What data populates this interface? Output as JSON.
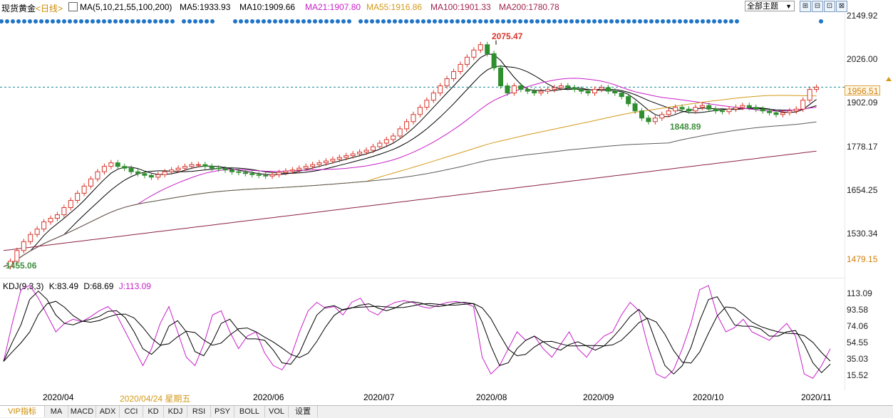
{
  "header": {
    "symbol": "现货黄金",
    "period": "<日线>",
    "ma_params": "MA(5,10,21,55,100,200)",
    "ma5": "MA5:1933.93",
    "ma10": "MA10:1909.66",
    "ma21": "MA21:1907.80",
    "ma55": "MA55:1916.86",
    "ma100": "MA100:1901.33",
    "ma200": "MA200:1780.78"
  },
  "toolbar": {
    "theme_select": "全部主题",
    "btn1": "⊞",
    "btn2": "⊟",
    "btn3": "⊡",
    "btn4": "⊠"
  },
  "price_axis": [
    "2149.92",
    "2026.00",
    "1902.09",
    "1778.17",
    "1654.25",
    "1530.34"
  ],
  "price_axis_low": "1479.15",
  "current_price": "1956.51",
  "annotations": {
    "high": "2075.47",
    "low": "1455.06",
    "mid_low": "1848.89"
  },
  "kdj": {
    "label": "KDJ(9,3,3)",
    "k": "K:83.49",
    "d": "D:68.69",
    "j": "J:113.09",
    "axis": [
      "113.09",
      "93.58",
      "74.06",
      "54.55",
      "35.03",
      "15.52"
    ]
  },
  "dates": {
    "d1": "2020/04",
    "cursor": "2020/04/24 星期五",
    "d2": "2020/06",
    "d3": "2020/07",
    "d4": "2020/08",
    "d5": "2020/09",
    "d6": "2020/10",
    "d7": "2020/11"
  },
  "tabs": [
    "VIP指标",
    "MA",
    "MACD",
    "ADX",
    "CCI",
    "KD",
    "KDJ",
    "RSI",
    "PSY",
    "BOLL",
    "VOL",
    "设置"
  ],
  "colors": {
    "ma5": "#000000",
    "ma10": "#000000",
    "ma21": "#c81ec8",
    "ma55": "#d39a1a",
    "ma100": "#5c5c5c",
    "ma200": "#8b2040",
    "up": "#d9352b",
    "down": "#2f8f2f",
    "dot": "#1e74c7"
  },
  "chart_data": {
    "type": "line",
    "ma_series_close": [
      1455,
      1470,
      1500,
      1525,
      1545,
      1560,
      1580,
      1590,
      1600,
      1620,
      1640,
      1660,
      1680,
      1700,
      1720,
      1735,
      1745,
      1735,
      1730,
      1720,
      1715,
      1710,
      1705,
      1712,
      1720,
      1725,
      1730,
      1735,
      1740,
      1740,
      1735,
      1730,
      1728,
      1725,
      1720,
      1718,
      1715,
      1712,
      1710,
      1708,
      1712,
      1718,
      1722,
      1725,
      1730,
      1735,
      1740,
      1745,
      1750,
      1755,
      1760,
      1765,
      1770,
      1775,
      1780,
      1790,
      1800,
      1810,
      1820,
      1840,
      1860,
      1880,
      1900,
      1920,
      1940,
      1960,
      1980,
      2000,
      2020,
      2040,
      2060,
      2075,
      2050,
      2010,
      1960,
      1940,
      1960,
      1950,
      1945,
      1940,
      1945,
      1950,
      1955,
      1960,
      1955,
      1950,
      1945,
      1940,
      1950,
      1955,
      1945,
      1940,
      1930,
      1910,
      1890,
      1870,
      1860,
      1870,
      1880,
      1890,
      1900,
      1895,
      1890,
      1900,
      1905,
      1895,
      1890,
      1888,
      1895,
      1900,
      1905,
      1900,
      1895,
      1890,
      1885,
      1880,
      1885,
      1890,
      1895,
      1920,
      1950,
      1956
    ]
  }
}
